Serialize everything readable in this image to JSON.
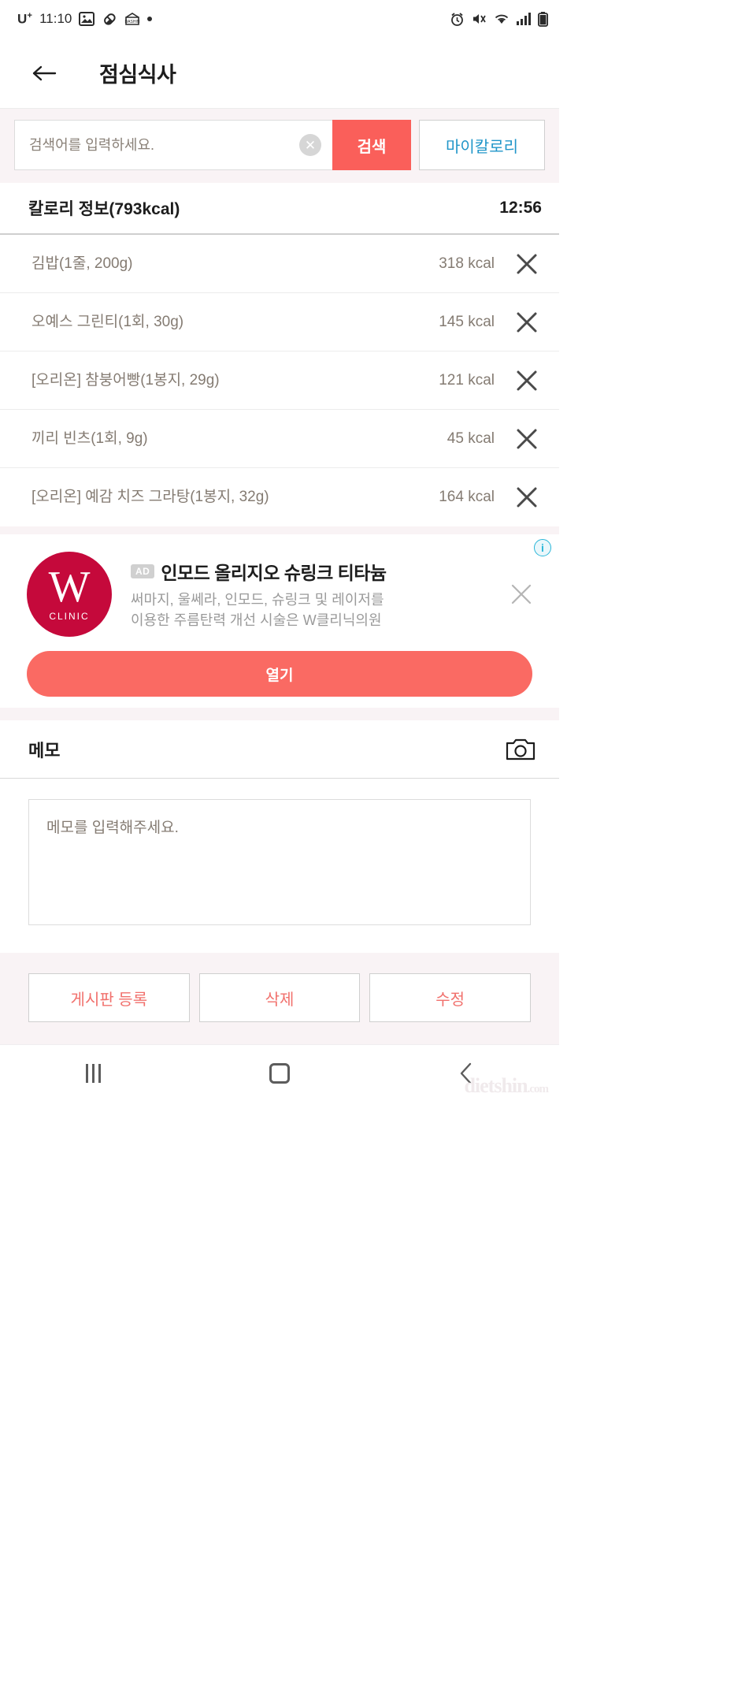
{
  "status_bar": {
    "carrier": "U",
    "carrier_sup": "+",
    "time": "11:10",
    "left_icons": [
      "image-icon",
      "pill-icon",
      "dashin-icon",
      "dot-icon"
    ],
    "right_icons": [
      "alarm-icon",
      "mute-icon",
      "wifi-icon",
      "signal-icon",
      "battery-icon"
    ]
  },
  "header": {
    "back_label": "←",
    "title": "점심식사"
  },
  "search": {
    "placeholder": "검색어를 입력하세요.",
    "value": "",
    "clear_label": "✕",
    "search_label": "검색",
    "mycalorie_label": "마이칼로리"
  },
  "calorie_section": {
    "title": "칼로리 정보(793kcal)",
    "total_kcal": 793,
    "time": "12:56",
    "delete_label": "✕",
    "items": [
      {
        "name": "김밥(1줄, 200g)",
        "kcal": "318 kcal"
      },
      {
        "name": "오예스 그린티(1회, 30g)",
        "kcal": "145 kcal"
      },
      {
        "name": "[오리온] 참붕어빵(1봉지, 29g)",
        "kcal": "121 kcal"
      },
      {
        "name": "끼리 빈츠(1회, 9g)",
        "kcal": "45 kcal"
      },
      {
        "name": "[오리온] 예감 치즈 그라탕(1봉지, 32g)",
        "kcal": "164 kcal"
      }
    ]
  },
  "ad": {
    "info_label": "i",
    "badge": "AD",
    "title": "인모드 올리지오 슈링크 티타늄",
    "desc_line1": "써마지, 울쎄라, 인모드, 슈링크 및 레이저를",
    "desc_line2": "이용한 주름탄력 개선 시술은 W클리닉의원",
    "logo_letter": "W",
    "logo_sub": "CLINIC",
    "close_label": "✕",
    "cta_label": "열기"
  },
  "memo": {
    "label": "메모",
    "placeholder": "메모를 입력해주세요.",
    "value": "",
    "camera_icon": "camera-icon"
  },
  "actions": {
    "board_register": "게시판 등록",
    "delete": "삭제",
    "edit": "수정"
  },
  "navbar": {
    "recents": "recents-icon",
    "home": "home-icon",
    "back": "back-icon",
    "watermark": "dietshin",
    "watermark_suffix": ".com"
  },
  "colors": {
    "accent_red": "#fa5f5a",
    "accent_pink": "#fa6a63",
    "link_blue": "#2196c9",
    "bg_pink": "#f9f3f5",
    "text_gray": "#847b72",
    "ad_logo_red": "#c5093b"
  }
}
